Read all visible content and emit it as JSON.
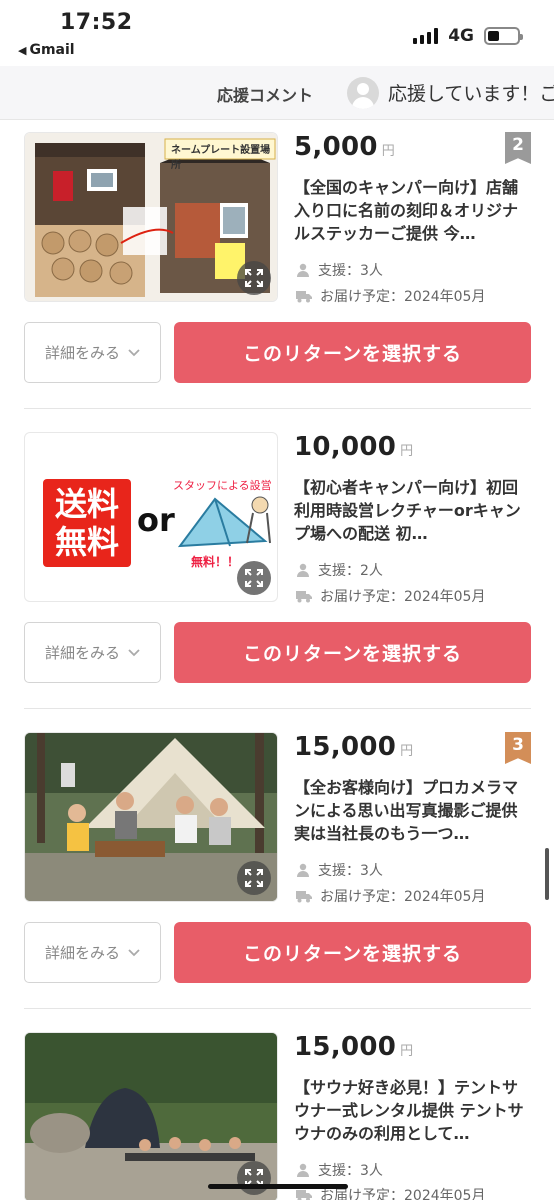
{
  "status_bar": {
    "time": "17:52",
    "back_app": "Gmail",
    "network": "4G"
  },
  "comment_bar": {
    "label": "応援コメント",
    "latest_comment": "応援しています！ご"
  },
  "rewards": [
    {
      "price": "5,000",
      "unit": "円",
      "rank": "2",
      "title": "【全国のキャンパー向け】店舗入り口に名前の刻印＆オリジナルステッカーご提供 今…",
      "supporters": "支援：3人",
      "delivery": "お届け予定：2024年05月",
      "image_caption": "ネームプレート設置場所",
      "detail_label": "詳細をみる",
      "select_label": "このリターンを選択する"
    },
    {
      "price": "10,000",
      "unit": "円",
      "rank": "",
      "title": "【初心者キャンパー向け】初回利用時設営レクチャーorキャンプ場への配送 初…",
      "supporters": "支援：2人",
      "delivery": "お届け予定：2024年05月",
      "image_free_shipping_1": "送料",
      "image_free_shipping_2": "無料",
      "image_or": "or",
      "image_staff_setup": "スタッフによる設営",
      "image_free": "無料！！",
      "detail_label": "詳細をみる",
      "select_label": "このリターンを選択する"
    },
    {
      "price": "15,000",
      "unit": "円",
      "rank": "3",
      "title": "【全お客様向け】プロカメラマンによる思い出写真撮影ご提供 実は当社長のもう一つ…",
      "supporters": "支援：3人",
      "delivery": "お届け予定：2024年05月",
      "detail_label": "詳細をみる",
      "select_label": "このリターンを選択する"
    },
    {
      "price": "15,000",
      "unit": "円",
      "rank": "",
      "title": "【サウナ好き必見！】テントサウナー式レンタル提供 テントサウナのみの利用として…",
      "supporters": "支援：3人",
      "delivery": "お届け予定：2024年05月"
    }
  ],
  "colors": {
    "accent_button": "#e85d68",
    "rank_2_badge": "#9a9a9a",
    "rank_3_badge": "#d38e58"
  }
}
